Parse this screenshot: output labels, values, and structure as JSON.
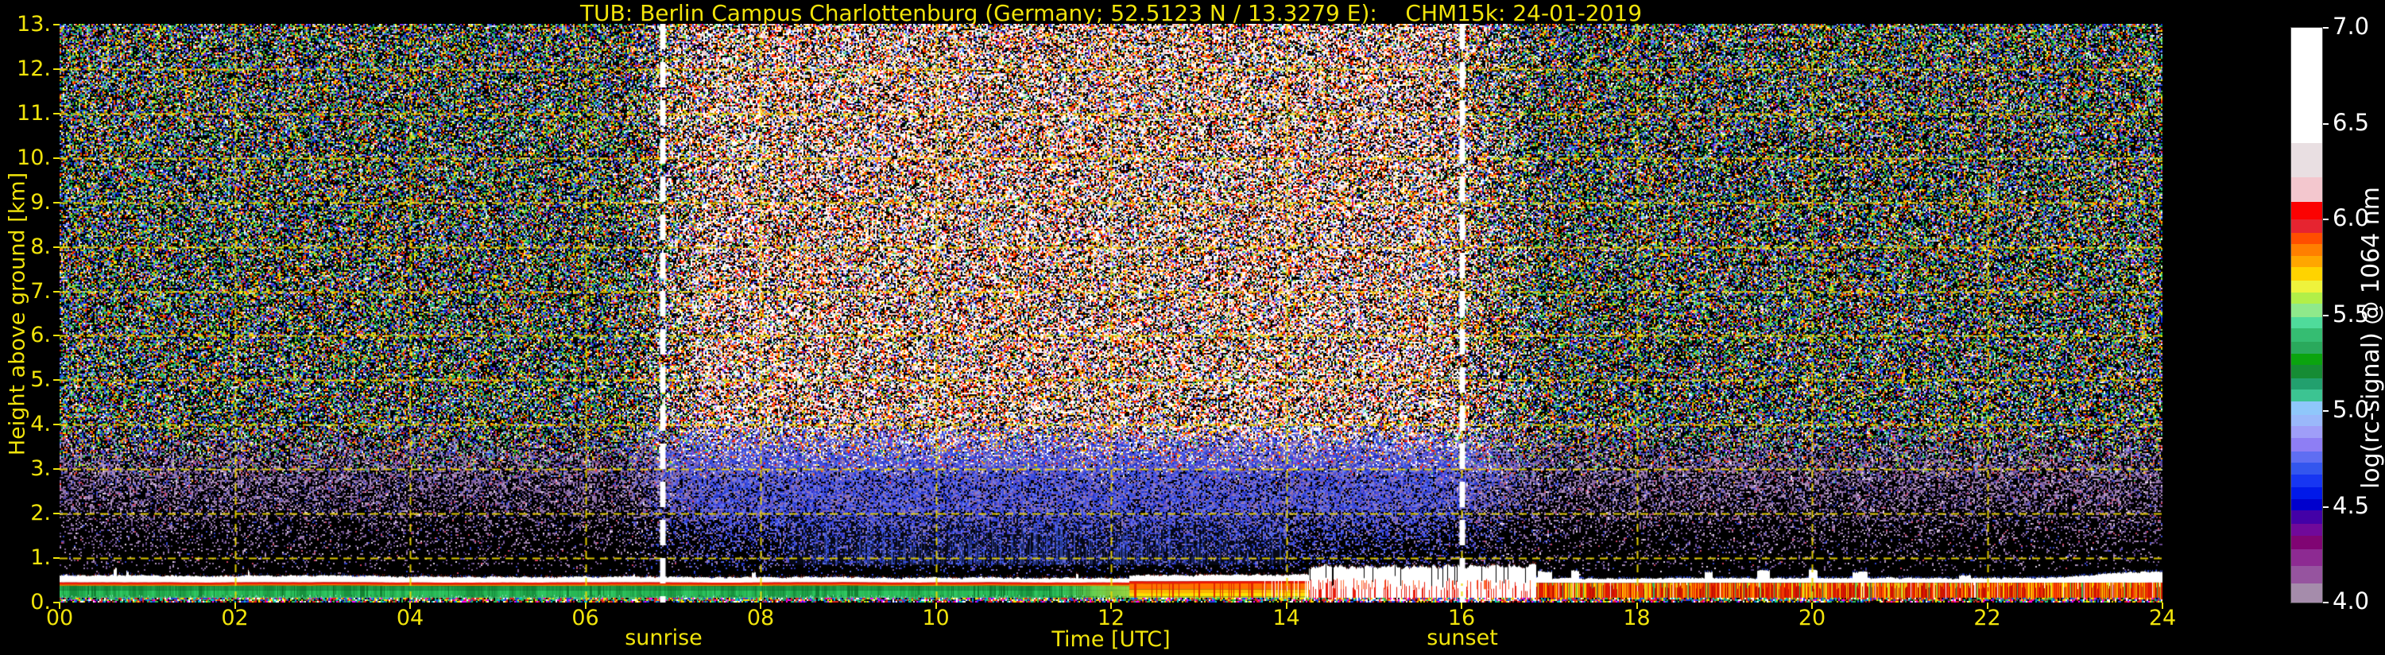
{
  "chart_data": {
    "type": "heatmap",
    "title": "TUB: Berlin Campus Charlottenburg (Germany; 52.5123 N / 13.3279 E):    CHM15k: 24-01-2019",
    "station": "TUB: Berlin Campus Charlottenburg",
    "country": "Germany",
    "coordinates": "52.5123 N / 13.3279 E",
    "instrument": "CHM15k",
    "date": "24-01-2019",
    "xlabel": "Time [UTC]",
    "ylabel": "Height above ground [km]",
    "xlim": [
      0,
      24
    ],
    "ylim": [
      0,
      13
    ],
    "x_ticks": [
      "00",
      "02",
      "04",
      "06",
      "08",
      "10",
      "12",
      "14",
      "16",
      "18",
      "20",
      "22",
      "24"
    ],
    "y_ticks": [
      "13.",
      "12.",
      "11.",
      "10.",
      "9.",
      "8.",
      "7.",
      "6.",
      "5.",
      "4.",
      "3.",
      "2.",
      "1.",
      "0."
    ],
    "grid": {
      "on": true,
      "style": "dashed",
      "x_step_hours": 2,
      "y_step_km": 1
    },
    "colors": {
      "background": "#000000",
      "label_yellow": "#f1e40b",
      "grid_yellow": "rgba(238,216,0,0.92)",
      "cbar_text": "#ffffff",
      "sun_line": "#ffffff"
    },
    "sun_events": {
      "sunrise": {
        "label": "sunrise",
        "t_utc": 6.88
      },
      "sunset": {
        "label": "sunset",
        "t_utc": 16.01
      }
    },
    "colorbar": {
      "label": "log(rc-signal) @ 1064 nm",
      "lim": [
        4.0,
        7.0
      ],
      "ticks": [
        "7.0",
        "6.5",
        "6.0",
        "5.5",
        "5.0",
        "4.5",
        "4.0"
      ],
      "tick_values": [
        7.0,
        6.5,
        6.0,
        5.5,
        5.0,
        4.5,
        4.0
      ],
      "segments": [
        {
          "v0": 6.4,
          "v1": 7.0,
          "c": "#ffffff"
        },
        {
          "v0": 6.22,
          "v1": 6.4,
          "c": "#e9dfe2"
        },
        {
          "v0": 6.09,
          "v1": 6.22,
          "c": "#f3c7ce"
        },
        {
          "v0": 6.0,
          "v1": 6.09,
          "c": "#fb0202"
        },
        {
          "v0": 5.93,
          "v1": 6.0,
          "c": "#e62430"
        },
        {
          "v0": 5.87,
          "v1": 5.93,
          "c": "#ff4e00"
        },
        {
          "v0": 5.81,
          "v1": 5.87,
          "c": "#ff7f00"
        },
        {
          "v0": 5.75,
          "v1": 5.81,
          "c": "#ffa600"
        },
        {
          "v0": 5.68,
          "v1": 5.75,
          "c": "#ffd300"
        },
        {
          "v0": 5.62,
          "v1": 5.68,
          "c": "#eef33c"
        },
        {
          "v0": 5.56,
          "v1": 5.62,
          "c": "#b2ef48"
        },
        {
          "v0": 5.49,
          "v1": 5.56,
          "c": "#8fe98b"
        },
        {
          "v0": 5.43,
          "v1": 5.49,
          "c": "#4fdb9b"
        },
        {
          "v0": 5.36,
          "v1": 5.43,
          "c": "#35bd72"
        },
        {
          "v0": 5.3,
          "v1": 5.36,
          "c": "#2aa95c"
        },
        {
          "v0": 5.24,
          "v1": 5.3,
          "c": "#0ba40f"
        },
        {
          "v0": 5.17,
          "v1": 5.24,
          "c": "#168c34"
        },
        {
          "v0": 5.11,
          "v1": 5.17,
          "c": "#22a06e"
        },
        {
          "v0": 5.05,
          "v1": 5.11,
          "c": "#3cc492"
        },
        {
          "v0": 4.98,
          "v1": 5.05,
          "c": "#8fc7fa"
        },
        {
          "v0": 4.92,
          "v1": 4.98,
          "c": "#9ab8fa"
        },
        {
          "v0": 4.86,
          "v1": 4.92,
          "c": "#9f9ef8"
        },
        {
          "v0": 4.79,
          "v1": 4.86,
          "c": "#8e7ef4"
        },
        {
          "v0": 4.73,
          "v1": 4.79,
          "c": "#5f6ef2"
        },
        {
          "v0": 4.67,
          "v1": 4.73,
          "c": "#3356ee"
        },
        {
          "v0": 4.6,
          "v1": 4.67,
          "c": "#1736f2"
        },
        {
          "v0": 4.54,
          "v1": 4.6,
          "c": "#0119e9"
        },
        {
          "v0": 4.48,
          "v1": 4.54,
          "c": "#0000cd"
        },
        {
          "v0": 4.41,
          "v1": 4.48,
          "c": "#4301a7"
        },
        {
          "v0": 4.35,
          "v1": 4.41,
          "c": "#70099a"
        },
        {
          "v0": 4.28,
          "v1": 4.35,
          "c": "#800473"
        },
        {
          "v0": 4.19,
          "v1": 4.28,
          "c": "#8d2a92"
        },
        {
          "v0": 4.1,
          "v1": 4.19,
          "c": "#96549f"
        },
        {
          "v0": 4.0,
          "v1": 4.1,
          "c": "#a58cab"
        }
      ]
    },
    "features": {
      "day_window": {
        "start_utc": 6.9,
        "end_utc": 16.0
      },
      "surface_layer_segments": [
        {
          "t0": 0.0,
          "t1": 12.2,
          "style": "green",
          "top_km": 0.62
        },
        {
          "t0": 12.2,
          "t1": 14.25,
          "style": "orange",
          "top_km": 0.63
        },
        {
          "t0": 14.25,
          "t1": 16.85,
          "style": "cloud",
          "top_km": 0.9
        },
        {
          "t0": 16.85,
          "t1": 24.0,
          "style": "red",
          "top_km": 0.56
        }
      ],
      "blue_haze_streaks": {
        "t0": 8.3,
        "t1": 14.0,
        "km0": 0.85,
        "km1": 1.95
      }
    },
    "noise_palettes": {
      "night_high": [
        [
          "#17a03c",
          8
        ],
        [
          "#35c860",
          6
        ],
        [
          "#a8e838",
          5
        ],
        [
          "#ffe000",
          6
        ],
        [
          "#ffa000",
          5
        ],
        [
          "#ff4800",
          5
        ],
        [
          "#e81800",
          5
        ],
        [
          "#ffffff",
          4
        ],
        [
          "#f2c6ce",
          3
        ],
        [
          "#2a52e8",
          9
        ],
        [
          "#0a28d8",
          6
        ],
        [
          "#7f8ff4",
          5
        ],
        [
          "#8a2be2",
          4
        ],
        [
          "#30c8a0",
          4
        ],
        [
          "#86ccfa",
          4
        ],
        [
          "#000000",
          21
        ]
      ],
      "day_high": [
        [
          "#ffffff",
          26
        ],
        [
          "#f0c6ce",
          12
        ],
        [
          "#e8dee2",
          8
        ],
        [
          "#ff1800",
          9
        ],
        [
          "#ff6000",
          6
        ],
        [
          "#ffa800",
          5
        ],
        [
          "#ffe000",
          4
        ],
        [
          "#2a52e8",
          6
        ],
        [
          "#86ccfa",
          3
        ],
        [
          "#35c860",
          4
        ],
        [
          "#8a2be2",
          3
        ],
        [
          "#000000",
          14
        ]
      ],
      "night_low": [
        [
          "#9b7fae",
          30
        ],
        [
          "#8a68a2",
          20
        ],
        [
          "#6a4a92",
          14
        ],
        [
          "#b89cc4",
          12
        ],
        [
          "#4a3a7e",
          8
        ],
        [
          "#3344cc",
          8
        ],
        [
          "#e8d8ee",
          4
        ],
        [
          "#d04060",
          4
        ]
      ],
      "day_low": [
        [
          "#3a50e0",
          26
        ],
        [
          "#2233c8",
          18
        ],
        [
          "#6a78ee",
          16
        ],
        [
          "#8060b0",
          14
        ],
        [
          "#9b7fae",
          14
        ],
        [
          "#5548d8",
          12
        ]
      ],
      "ground": [
        [
          "#e02020",
          22
        ],
        [
          "#2040e0",
          18
        ],
        [
          "#ffe000",
          14
        ],
        [
          "#00c8c8",
          8
        ],
        [
          "#ffffff",
          10
        ],
        [
          "#ff00ff",
          6
        ],
        [
          "#30c050",
          10
        ],
        [
          "#000000",
          12
        ]
      ]
    },
    "band_palettes": {
      "greens": [
        "#17913d",
        "#1fa449",
        "#27b855",
        "#2fc661",
        "#128233"
      ],
      "yellow_blend": "#a8d83c",
      "cyan_fleck": "#8ae8c0",
      "red_line": "#f21604",
      "orange_line": "#ff8200"
    }
  }
}
